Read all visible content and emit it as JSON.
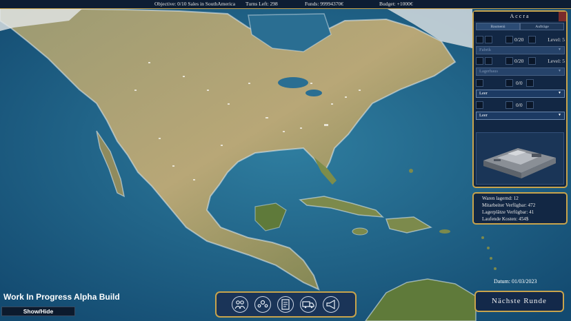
{
  "topbar": {
    "objective": "Objective:  0/10 Sales in SouthAmerica",
    "turns": "Turns Left: 298",
    "funds": "Funds: 99994370€",
    "budget": "Budget: +1000€"
  },
  "city_panel": {
    "title": "Accra",
    "tabs": [
      "Baumenü",
      "Aufträge"
    ],
    "slot1": {
      "count": "0/20",
      "level": "Level: 5",
      "type": "Fabrik"
    },
    "slot2": {
      "count": "0/20",
      "level": "Level: 5",
      "type": "Lagerhaus"
    },
    "slot3": {
      "count": "0/0",
      "type": "Leer"
    },
    "slot4": {
      "count": "0/0",
      "type": "Leer"
    }
  },
  "info_panel": {
    "goods": "Waren lagernd: 12",
    "staff": "Mitarbeiter Verfügbar: 472",
    "storage": "Lagerplätze Verfügbar: 41",
    "costs": "Laufende Kosten: 454$"
  },
  "date": "Datum: 01/03/2023",
  "next_turn_label": "Nächste Runde",
  "wip_label": "Work In Progress Alpha Build",
  "show_hide_label": "Show/Hide",
  "toolbar_icons": [
    "group-icon",
    "team-icon",
    "document-icon",
    "truck-icon",
    "megaphone-icon"
  ],
  "colors": {
    "accent_gold": "#c9a44c",
    "panel_bg": "#122744",
    "ocean": "#1d5f86"
  }
}
